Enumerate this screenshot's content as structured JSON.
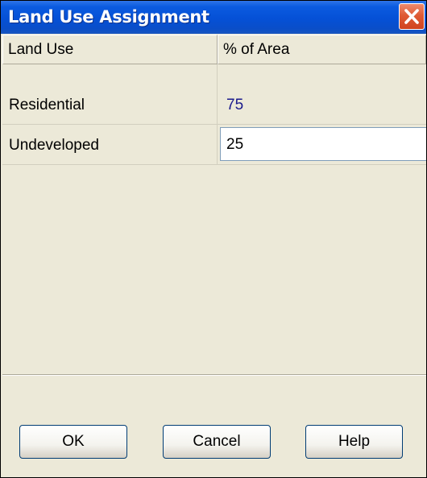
{
  "window": {
    "title": "Land Use Assignment"
  },
  "table": {
    "columns": [
      "Land Use",
      "% of Area"
    ],
    "rows": [
      {
        "land_use": "Residential",
        "percent": "75"
      },
      {
        "land_use": "Undeveloped",
        "percent": "25"
      }
    ],
    "editing_row_value": "25"
  },
  "buttons": {
    "ok": "OK",
    "cancel": "Cancel",
    "help": "Help"
  },
  "colors": {
    "titlebar": "#0550d6",
    "close_button": "#df5b35",
    "dialog_background": "#ece9d8",
    "value_text": "#1a1a8c"
  },
  "icons": {
    "close": "close-icon"
  }
}
